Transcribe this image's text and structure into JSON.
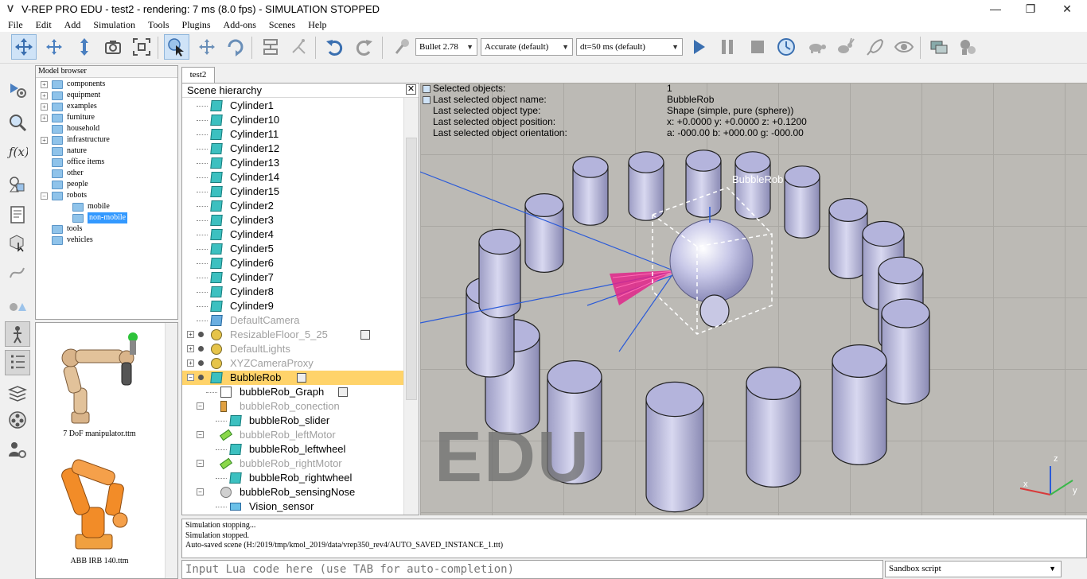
{
  "window": {
    "title": "V-REP PRO EDU - test2 - rendering: 7 ms (8.0 fps) - SIMULATION STOPPED",
    "minimize": "—",
    "restore": "❐",
    "close": "✕"
  },
  "menu": [
    "File",
    "Edit",
    "Add",
    "Simulation",
    "Tools",
    "Plugins",
    "Add-ons",
    "Scenes",
    "Help"
  ],
  "toolbar": {
    "engine": "Bullet 2.78",
    "accuracy": "Accurate (default)",
    "timestep": "dt=50 ms (default)"
  },
  "model_browser": {
    "title": "Model browser",
    "items": [
      {
        "label": "components",
        "expander": "+"
      },
      {
        "label": "equipment",
        "expander": "+"
      },
      {
        "label": "examples",
        "expander": "+"
      },
      {
        "label": "furniture",
        "expander": "+"
      },
      {
        "label": "household",
        "expander": ""
      },
      {
        "label": "infrastructure",
        "expander": "+"
      },
      {
        "label": "nature",
        "expander": ""
      },
      {
        "label": "office items",
        "expander": ""
      },
      {
        "label": "other",
        "expander": ""
      },
      {
        "label": "people",
        "expander": ""
      },
      {
        "label": "robots",
        "expander": "−"
      },
      {
        "label": "mobile",
        "expander": ""
      },
      {
        "label": "non-mobile",
        "expander": ""
      },
      {
        "label": "tools",
        "expander": ""
      },
      {
        "label": "vehicles",
        "expander": ""
      }
    ],
    "thumbnails": [
      "7 DoF manipulator.ttm",
      "ABB IRB 140.ttm"
    ]
  },
  "tabs": [
    "test2"
  ],
  "hierarchy": {
    "title": "Scene hierarchy",
    "close": "✕",
    "rows": [
      {
        "label": "Cylinder1"
      },
      {
        "label": "Cylinder10"
      },
      {
        "label": "Cylinder11"
      },
      {
        "label": "Cylinder12"
      },
      {
        "label": "Cylinder13"
      },
      {
        "label": "Cylinder14"
      },
      {
        "label": "Cylinder15"
      },
      {
        "label": "Cylinder2"
      },
      {
        "label": "Cylinder3"
      },
      {
        "label": "Cylinder4"
      },
      {
        "label": "Cylinder5"
      },
      {
        "label": "Cylinder6"
      },
      {
        "label": "Cylinder7"
      },
      {
        "label": "Cylinder8"
      },
      {
        "label": "Cylinder9"
      },
      {
        "label": "DefaultCamera"
      },
      {
        "label": "ResizableFloor_5_25"
      },
      {
        "label": "DefaultLights"
      },
      {
        "label": "XYZCameraProxy"
      },
      {
        "label": "BubbleRob"
      },
      {
        "label": "bubbleRob_Graph"
      },
      {
        "label": "bubbleRob_conection"
      },
      {
        "label": "bubbleRob_slider"
      },
      {
        "label": "bubbleRob_leftMotor"
      },
      {
        "label": "bubbleRob_leftwheel"
      },
      {
        "label": "bubbleRob_rightMotor"
      },
      {
        "label": "bubbleRob_rightwheel"
      },
      {
        "label": "bubbleRob_sensingNose"
      },
      {
        "label": "Vision_sensor"
      }
    ]
  },
  "viewport": {
    "info": [
      {
        "label": "Selected objects:",
        "value": "1"
      },
      {
        "label": "Last selected object name:",
        "value": "BubbleRob"
      },
      {
        "label": "Last selected object type:",
        "value": "Shape (simple, pure (sphere))"
      },
      {
        "label": "Last selected object position:",
        "value": "x: +0.0000    y: +0.0000    z: +0.1200"
      },
      {
        "label": "Last selected object orientation:",
        "value": "a: -000.00    b: +000.00    g: -000.00"
      }
    ],
    "object_label": "BubbleRob",
    "watermark": "EDU",
    "axes": {
      "z": "z",
      "x": "x",
      "y": "y"
    }
  },
  "console": {
    "lines": [
      "Simulation stopping...",
      "Simulation stopped.",
      "Auto-saved scene (H:/2019/tmp/kmol_2019/data/vrep350_rev4/AUTO_SAVED_INSTANCE_1.ttt)"
    ]
  },
  "lua": {
    "placeholder": "Input Lua code here (use TAB for auto-completion)",
    "mode": "Sandbox script"
  }
}
